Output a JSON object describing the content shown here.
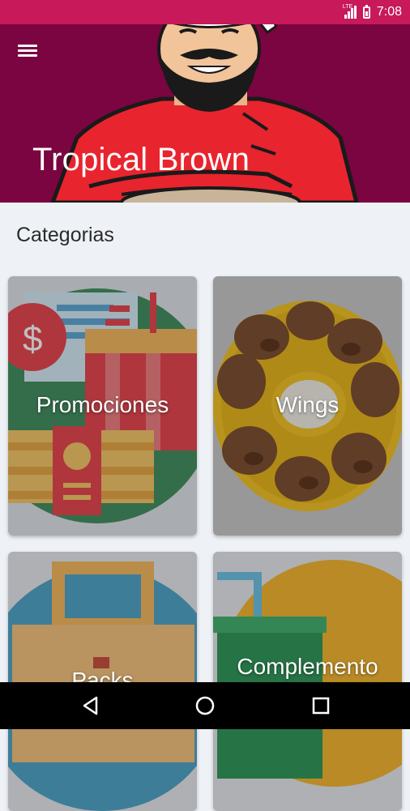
{
  "status_bar": {
    "network": "LTE",
    "time": "7:08"
  },
  "header": {
    "title": "Tropical Brown",
    "menu_icon": "hamburger-menu-icon"
  },
  "main": {
    "section_title": "Categorias",
    "categories": [
      {
        "label": "Promociones"
      },
      {
        "label": "Wings"
      },
      {
        "label": "Packs"
      },
      {
        "label": "Complemento"
      }
    ]
  },
  "nav_bar": {
    "back_icon": "back-triangle-icon",
    "home_icon": "home-circle-icon",
    "recents_icon": "recents-square-icon"
  },
  "colors": {
    "status_bar": "#c8195a",
    "hero_bg": "#7a0540",
    "page_bg": "#eef1f6"
  }
}
